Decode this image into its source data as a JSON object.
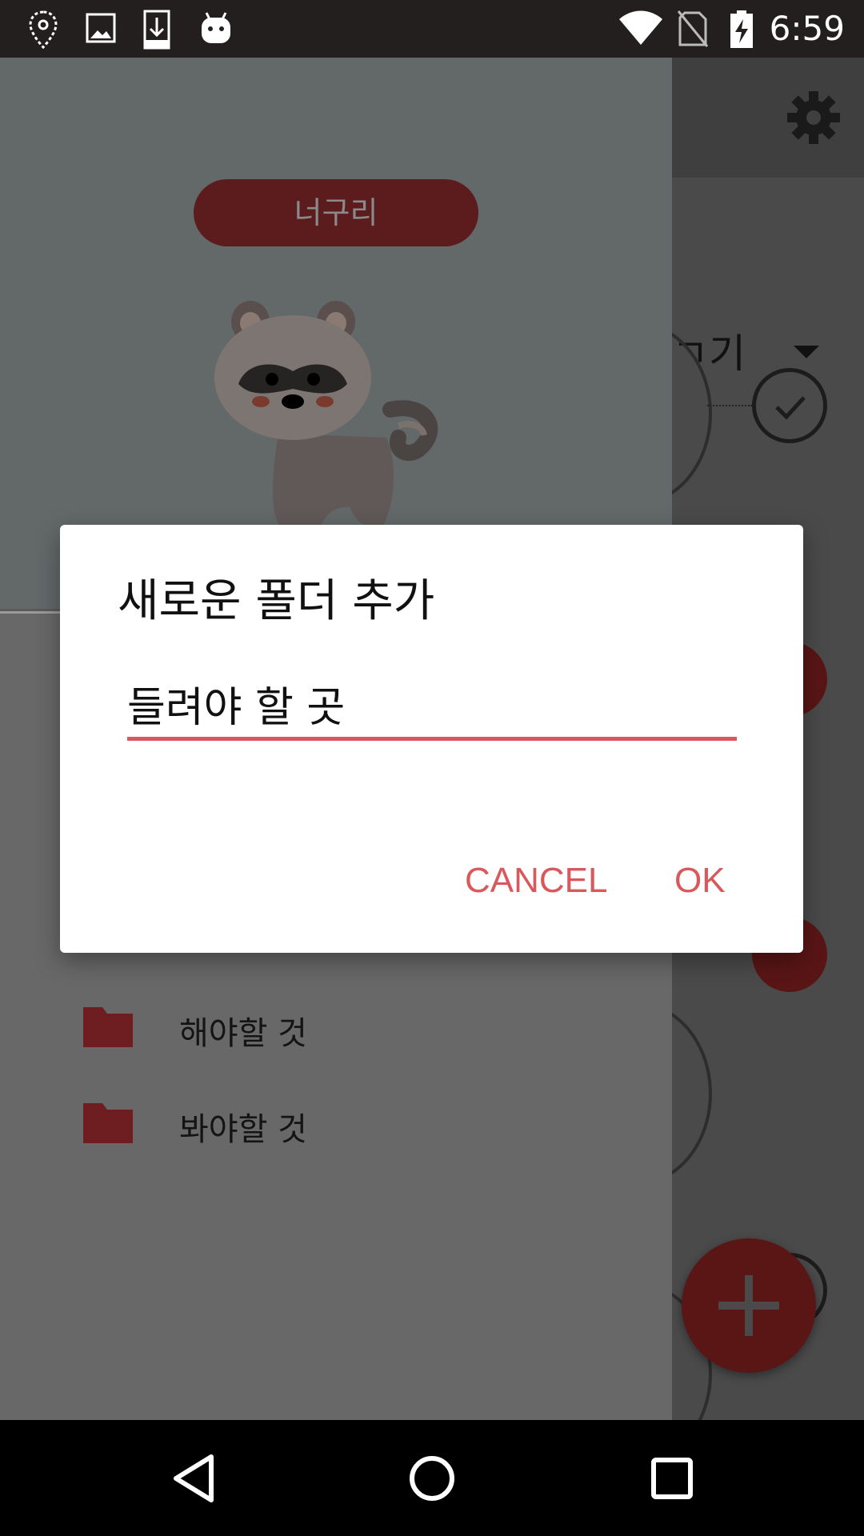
{
  "status_bar": {
    "time": "6:59",
    "left_icons": [
      "location-pin-icon",
      "image-icon",
      "download-icon",
      "android-icon"
    ],
    "right_icons": [
      "wifi-icon",
      "no-sim-icon",
      "battery-charging-icon"
    ]
  },
  "background_app": {
    "sort_label": "ㄱ기",
    "fab_icon": "plus-icon"
  },
  "drawer": {
    "profile_name": "너구리",
    "folders": [
      {
        "label": "해야할 것"
      },
      {
        "label": "봐야할 것"
      }
    ]
  },
  "dialog": {
    "title": "새로운 폴더 추가",
    "input_value": "들려야 할 곳",
    "cancel_label": "CANCEL",
    "ok_label": "OK"
  },
  "colors": {
    "accent": "#d9585c",
    "status_bar": "#231f1f",
    "folder_icon": "#6e1e20"
  },
  "nav_bar": {
    "buttons": [
      "back-icon",
      "home-icon",
      "recents-icon"
    ]
  }
}
